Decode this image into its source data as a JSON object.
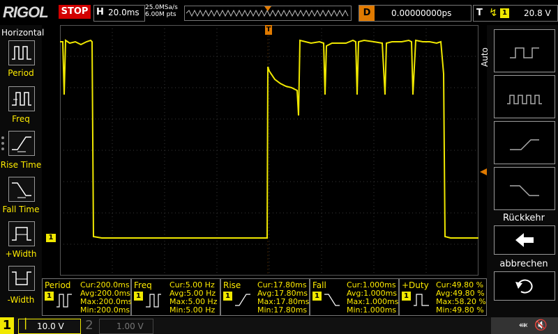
{
  "topbar": {
    "logo": "RIGOL",
    "run_state": "STOP",
    "horizontal_label": "H",
    "timebase": "20.0ms",
    "sample_rate": "25.0MSa/s",
    "memory_depth": "6.00M pts",
    "delay_label": "D",
    "delay_value": "0.00000000ps",
    "trigger_label": "T",
    "trigger_channel": "1",
    "trigger_level": "20.8 V"
  },
  "left_panel": {
    "title": "Horizontal",
    "items": [
      {
        "label": "Period",
        "icon": "period-icon"
      },
      {
        "label": "Freq",
        "icon": "frequency-icon"
      },
      {
        "label": "Rise Time",
        "icon": "rise-time-icon"
      },
      {
        "label": "Fall Time",
        "icon": "fall-time-icon"
      },
      {
        "label": "+Width",
        "icon": "positive-width-icon"
      },
      {
        "label": "-Width",
        "icon": "negative-width-icon"
      }
    ]
  },
  "right_panel": {
    "tab_label": "Auto",
    "back_label": "Rückkehr",
    "cancel_label": "abbrechen"
  },
  "measurements": [
    {
      "name": "Period",
      "ch": "1",
      "cur": "Cur:200.0ms",
      "avg": "Avg:200.0ms",
      "max": "Max:200.0ms",
      "min": "Min:200.0ms"
    },
    {
      "name": "Freq",
      "ch": "1",
      "cur": "Cur:5.00 Hz",
      "avg": "Avg:5.00 Hz",
      "max": "Max:5.00 Hz",
      "min": "Min:5.00 Hz"
    },
    {
      "name": "Rise",
      "ch": "1",
      "cur": "Cur:17.80ms",
      "avg": "Avg:17.80ms",
      "max": "Max:17.80ms",
      "min": "Min:17.80ms"
    },
    {
      "name": "Fall",
      "ch": "1",
      "cur": "Cur:1.000ms",
      "avg": "Avg:1.000ms",
      "max": "Max:1.000ms",
      "min": "Min:1.000ms"
    },
    {
      "name": "+Duty",
      "ch": "1",
      "cur": "Cur:49.80 %",
      "avg": "Avg:49.80 %",
      "max": "Max:58.20 %",
      "min": "Min:49.80 %"
    }
  ],
  "channels": {
    "ch1_number": "1",
    "ch1_scale": "10.0 V",
    "ch2_number": "2",
    "ch2_scale": "1.00 V"
  },
  "markers": {
    "ch1_ground": "1",
    "trigger_pos": "T"
  },
  "colors": {
    "ch1": "#f0e800",
    "stop": "#d20000",
    "delay": "#e07a00",
    "grid": "#444444"
  }
}
